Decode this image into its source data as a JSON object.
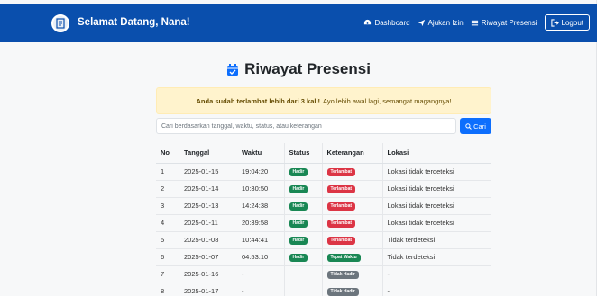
{
  "navbar": {
    "title": "Selamat Datang, Nana!",
    "links": [
      {
        "label": "Dashboard",
        "icon": "dashboard-icon"
      },
      {
        "label": "Ajukan Izin",
        "icon": "send-icon"
      },
      {
        "label": "Riwayat Presensi",
        "icon": "list-icon"
      }
    ],
    "logout_label": "Logout"
  },
  "page": {
    "title": "Riwayat Presensi"
  },
  "alert": {
    "bold": "Anda sudah terlambat lebih dari 3 kali!",
    "text": "Ayo lebih awal lagi, semangat magangnya!"
  },
  "search": {
    "placeholder": "Cari berdasarkan tanggal, waktu, status, atau keterangan",
    "button_label": "Cari"
  },
  "table": {
    "headers": [
      "No",
      "Tanggal",
      "Waktu",
      "Status",
      "Keterangan",
      "Lokasi"
    ],
    "rows": [
      {
        "no": "1",
        "tanggal": "2025-01-15",
        "waktu": "19:04:20",
        "status": "Hadir",
        "keterangan": "Terlambat",
        "lokasi": "Lokasi tidak terdeteksi"
      },
      {
        "no": "2",
        "tanggal": "2025-01-14",
        "waktu": "10:30:50",
        "status": "Hadir",
        "keterangan": "Terlambat",
        "lokasi": "Lokasi tidak terdeteksi"
      },
      {
        "no": "3",
        "tanggal": "2025-01-13",
        "waktu": "14:24:38",
        "status": "Hadir",
        "keterangan": "Terlambat",
        "lokasi": "Lokasi tidak terdeteksi"
      },
      {
        "no": "4",
        "tanggal": "2025-01-11",
        "waktu": "20:39:58",
        "status": "Hadir",
        "keterangan": "Terlambat",
        "lokasi": "Lokasi tidak terdeteksi"
      },
      {
        "no": "5",
        "tanggal": "2025-01-08",
        "waktu": "10:44:41",
        "status": "Hadir",
        "keterangan": "Terlambat",
        "lokasi": "Tidak terdeteksi"
      },
      {
        "no": "6",
        "tanggal": "2025-01-07",
        "waktu": "04:53:10",
        "status": "Hadir",
        "keterangan": "Tepat Waktu",
        "lokasi": "Tidak terdeteksi"
      },
      {
        "no": "7",
        "tanggal": "2025-01-16",
        "waktu": "-",
        "status": "",
        "keterangan": "Tidak Hadir",
        "lokasi": "-"
      },
      {
        "no": "8",
        "tanggal": "2025-01-17",
        "waktu": "-",
        "status": "",
        "keterangan": "Tidak Hadir",
        "lokasi": "-"
      }
    ]
  },
  "colors": {
    "navbar": "#0a4fad",
    "hadir": "#198754",
    "terlambat": "#dc3545",
    "tepat_waktu": "#198754",
    "tidak_hadir": "#6c757d",
    "primary": "#0d6efd"
  }
}
